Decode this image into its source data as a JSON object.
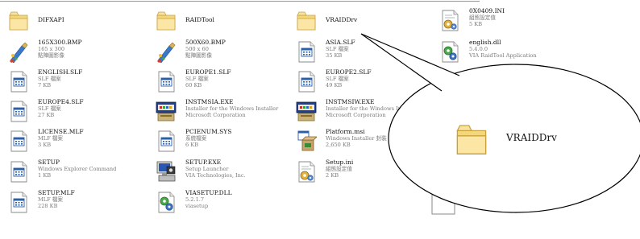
{
  "files": [
    {
      "name": "DIFXAPI",
      "l2": "",
      "l3": "",
      "icon": "folder-icon"
    },
    {
      "name": "RAIDTool",
      "l2": "",
      "l3": "",
      "icon": "folder-icon"
    },
    {
      "name": "VRAIDDrv",
      "l2": "",
      "l3": "",
      "icon": "folder-icon"
    },
    {
      "name": "0X0409.INI",
      "l2": "組態設定值",
      "l3": "5 KB",
      "icon": "ini-settings-icon"
    },
    {
      "name": "165X300.BMP",
      "l2": "165 x 300",
      "l3": "點陣圖影像",
      "icon": "bitmap-paint-icon"
    },
    {
      "name": "500X60.BMP",
      "l2": "500 x 60",
      "l3": "點陣圖影像",
      "icon": "bitmap-paint-icon"
    },
    {
      "name": "ASIA.SLF",
      "l2": "SLF 檔案",
      "l3": "35 KB",
      "icon": "generic-file-icon"
    },
    {
      "name": "english.dll",
      "l2": "5.4.0.0",
      "l3": "VIA RaidTool Application",
      "icon": "dll-gear-icon"
    },
    {
      "name": "ENGLISH.SLF",
      "l2": "SLF 檔案",
      "l3": "7 KB",
      "icon": "generic-file-icon"
    },
    {
      "name": "EUROPE1.SLF",
      "l2": "SLF 檔案",
      "l3": "60 KB",
      "icon": "generic-file-icon"
    },
    {
      "name": "EUROPE2.SLF",
      "l2": "SLF 檔案",
      "l3": "49 KB",
      "icon": "generic-file-icon"
    },
    {
      "name": "EUROPE4.SLF",
      "l2": "SLF 檔案",
      "l3": "27 KB",
      "icon": "generic-file-icon"
    },
    {
      "name": "INSTMSIA.EXE",
      "l2": "Installer for the Windows Installer",
      "l3": "Microsoft Corporation",
      "icon": "installer-exe-icon"
    },
    {
      "name": "INSTMSIW.EXE",
      "l2": "Installer for the Windows Installer",
      "l3": "Microsoft Corporation",
      "icon": "installer-exe-icon"
    },
    {
      "name": "LICENSE.MLF",
      "l2": "MLF 檔案",
      "l3": "3 KB",
      "icon": "generic-file-icon"
    },
    {
      "name": "PCIENUM.SYS",
      "l2": "系統檔案",
      "l3": "6 KB",
      "icon": "generic-file-icon"
    },
    {
      "name": "Platform.msi",
      "l2": "Windows Installer 封裝",
      "l3": "2,650 KB",
      "icon": "msi-package-icon"
    },
    {
      "name": "SETUP",
      "l2": "Windows Explorer Command",
      "l3": "1 KB",
      "icon": "generic-file-icon"
    },
    {
      "name": "SETUP.EXE",
      "l2": "Setup Launcher",
      "l3": "VIA Technologies, Inc.",
      "icon": "setup-computer-icon"
    },
    {
      "name": "Setup.ini",
      "l2": "組態設定值",
      "l3": "2 KB",
      "icon": "ini-settings-icon"
    },
    {
      "name": "SETUP.MLF",
      "l2": "MLF 檔案",
      "l3": "228 KB",
      "icon": "generic-file-icon"
    },
    {
      "name": "VIASETUP.DLL",
      "l2": "5.2.1.7",
      "l3": "viasetup",
      "icon": "dll-gear-icon"
    }
  ],
  "callout": {
    "label": "VRAIDDrv",
    "icon": "folder-icon"
  }
}
